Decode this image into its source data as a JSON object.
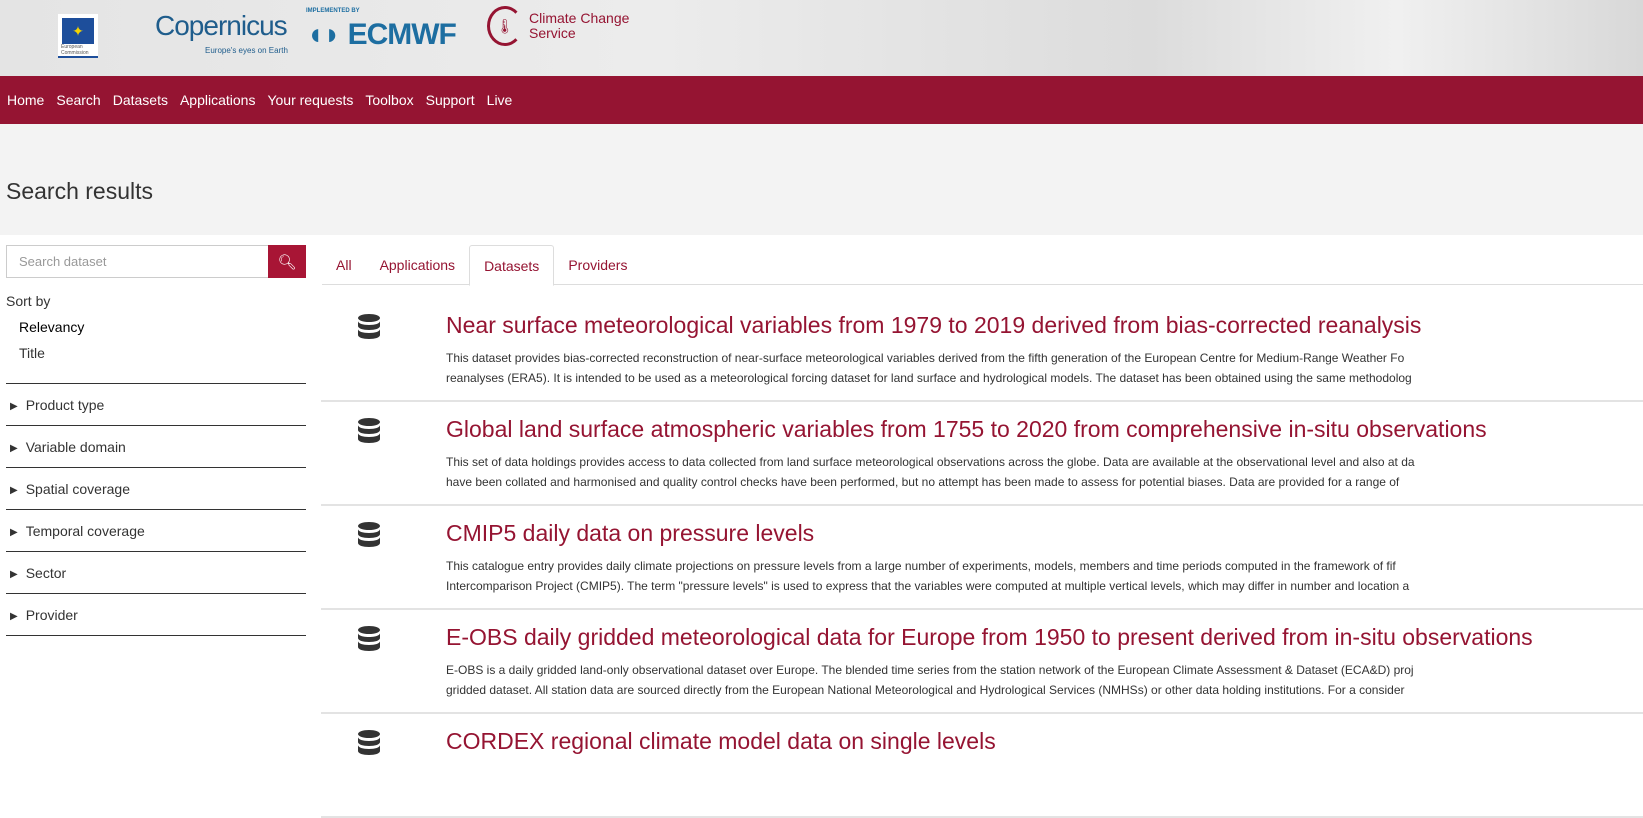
{
  "header": {
    "logos": {
      "eu": "European Commission",
      "copernicus": "opernicus",
      "copernicus_tagline": "Europe's eyes on Earth",
      "implemented_by": "IMPLEMENTED BY",
      "ecmwf": "ECMWF",
      "c3s_line1": "Climate Change",
      "c3s_line2": "Service"
    }
  },
  "nav": [
    "Home",
    "Search",
    "Datasets",
    "Applications",
    "Your requests",
    "Toolbox",
    "Support",
    "Live"
  ],
  "page_title": "Search results",
  "search": {
    "placeholder": "Search dataset",
    "value": ""
  },
  "sort": {
    "label": "Sort by",
    "options": [
      "Relevancy",
      "Title"
    ],
    "selected": "Relevancy"
  },
  "facets": [
    "Product type",
    "Variable domain",
    "Spatial coverage",
    "Temporal coverage",
    "Sector",
    "Provider"
  ],
  "tabs": [
    "All",
    "Applications",
    "Datasets",
    "Providers"
  ],
  "active_tab": "Datasets",
  "results": [
    {
      "title": "Near surface meteorological variables from 1979 to 2019 derived from bias-corrected reanalysis",
      "line1": "This dataset provides bias-corrected reconstruction of near-surface meteorological variables derived from the fifth generation of the European Centre for Medium-Range Weather Fo",
      "line2": "reanalyses (ERA5). It is intended to be used as a meteorological forcing dataset for land surface and hydrological models. The dataset has been obtained using the same methodolog"
    },
    {
      "title": "Global land surface atmospheric variables from 1755 to 2020 from comprehensive in-situ observations",
      "line1": "This set of data holdings provides access to data collected from land surface meteorological observations across the globe. Data are available at the observational level and also at da",
      "line2": "have been collated and harmonised and quality control checks have been performed, but no attempt has been made to assess for potential biases. Data are provided for a range of"
    },
    {
      "title": "CMIP5 daily data on pressure levels",
      "line1": "This catalogue entry provides daily climate projections on pressure levels from a large number of experiments, models, members and time periods computed in the framework of fif",
      "line2": "Intercomparison Project (CMIP5). The term \"pressure levels\" is used to express that the variables were computed at multiple vertical levels, which may differ in number and location a"
    },
    {
      "title": "E-OBS daily gridded meteorological data for Europe from 1950 to present derived from in-situ observations",
      "line1": "E-OBS is a daily gridded land-only observational dataset over Europe. The blended time series from the station network of the European Climate Assessment & Dataset (ECA&D) proj",
      "line2": "gridded dataset. All station data are sourced directly from the European National Meteorological and Hydrological Services (NMHSs) or other data holding institutions. For a consider"
    },
    {
      "title": "CORDEX regional climate model data on single levels",
      "line1": "",
      "line2": ""
    }
  ],
  "colors": {
    "brand": "#951432",
    "band": "#f3f3f3"
  }
}
